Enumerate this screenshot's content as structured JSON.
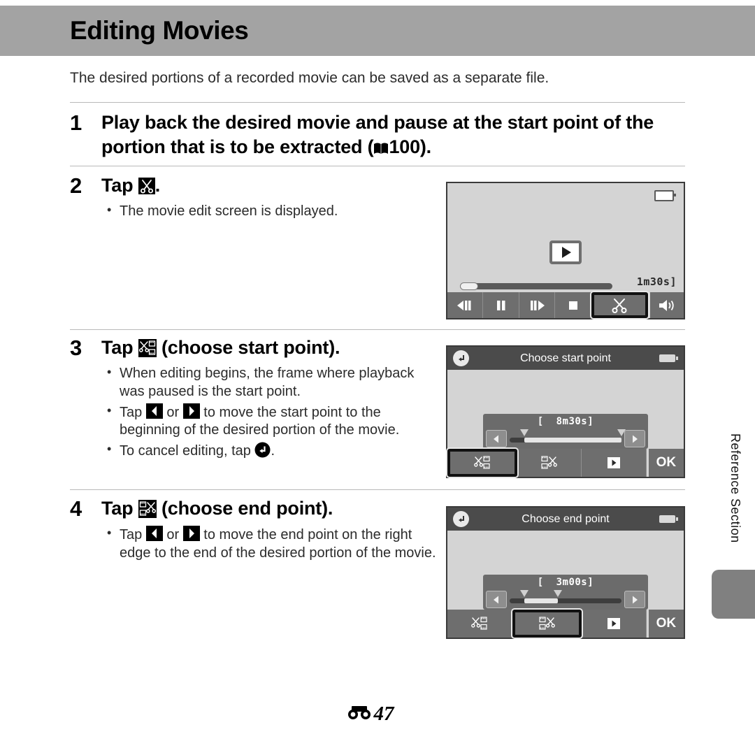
{
  "page": {
    "title": "Editing Movies",
    "intro": "The desired portions of a recorded movie can be saved as a separate file.",
    "side_tab_label": "Reference Section",
    "footer_page": "47"
  },
  "steps": [
    {
      "number": "1",
      "head_before": "Play back the desired movie and pause at the start point of the portion that is to be extracted (",
      "head_icon": "book-icon",
      "head_ref": "100",
      "head_after": ").",
      "bullets": []
    },
    {
      "number": "2",
      "head_before": "Tap ",
      "head_icon": "scissors-icon",
      "head_after": ".",
      "bullets": [
        "The movie edit screen is displayed."
      ]
    },
    {
      "number": "3",
      "head_before": "Tap ",
      "head_icon": "choose-start-point-icon",
      "head_after": " (choose start point).",
      "bullets": [
        "When editing begins, the frame where playback was paused is the start point.",
        "Tap [left] or [right] to move the start point to the beginning of the desired portion of the movie.",
        "To cancel editing, tap [back]."
      ],
      "bullet2_before": "Tap ",
      "bullet2_mid": " or ",
      "bullet2_after": " to move the start point to the beginning of the desired portion of the movie.",
      "bullet3_before": "To cancel editing, tap ",
      "bullet3_after": "."
    },
    {
      "number": "4",
      "head_before": "Tap ",
      "head_icon": "choose-end-point-icon",
      "head_after": " (choose end point).",
      "bullet1_before": "Tap ",
      "bullet1_mid": " or ",
      "bullet1_after": " to move the end point on the right edge to the end of the desired portion of the movie."
    }
  ],
  "screens": {
    "playback": {
      "duration": "1m30s",
      "bracket_open": "[",
      "bracket_close": "]",
      "battery": "battery-empty-icon",
      "center_button": "play-icon",
      "controls": [
        {
          "name": "rewind-button",
          "icon": "rewind-icon",
          "selected": false
        },
        {
          "name": "pause-button",
          "icon": "pause-icon",
          "selected": false
        },
        {
          "name": "advance-button",
          "icon": "advance-icon",
          "selected": false
        },
        {
          "name": "stop-button",
          "icon": "stop-icon",
          "selected": false
        },
        {
          "name": "scissors-button",
          "icon": "scissors-icon",
          "selected": true
        },
        {
          "name": "volume-button",
          "icon": "volume-icon",
          "selected": false
        }
      ]
    },
    "start_point": {
      "title": "Choose start point",
      "duration": "8m30s",
      "bracket_open": "[",
      "bracket_close": "]",
      "back": "back-icon",
      "battery": "battery-full-icon",
      "slider": {
        "fill_left_pct": 13,
        "fill_width_pct": 87
      },
      "ok_label": "OK",
      "controls": [
        {
          "name": "choose-start-point-button",
          "icon": "choose-start-point-icon",
          "selected": true
        },
        {
          "name": "choose-end-point-button",
          "icon": "choose-end-point-icon",
          "selected": false
        },
        {
          "name": "preview-play-button",
          "icon": "play-icon",
          "selected": false
        }
      ]
    },
    "end_point": {
      "title": "Choose end point",
      "duration": "3m00s",
      "bracket_open": "[",
      "bracket_close": "]",
      "back": "back-icon",
      "battery": "battery-full-icon",
      "slider": {
        "fill_left_pct": 13,
        "fill_width_pct": 30
      },
      "ok_label": "OK",
      "controls": [
        {
          "name": "choose-start-point-button",
          "icon": "choose-start-point-icon",
          "selected": false
        },
        {
          "name": "choose-end-point-button",
          "icon": "choose-end-point-icon",
          "selected": true
        },
        {
          "name": "preview-play-button",
          "icon": "play-icon",
          "selected": false
        }
      ]
    }
  }
}
